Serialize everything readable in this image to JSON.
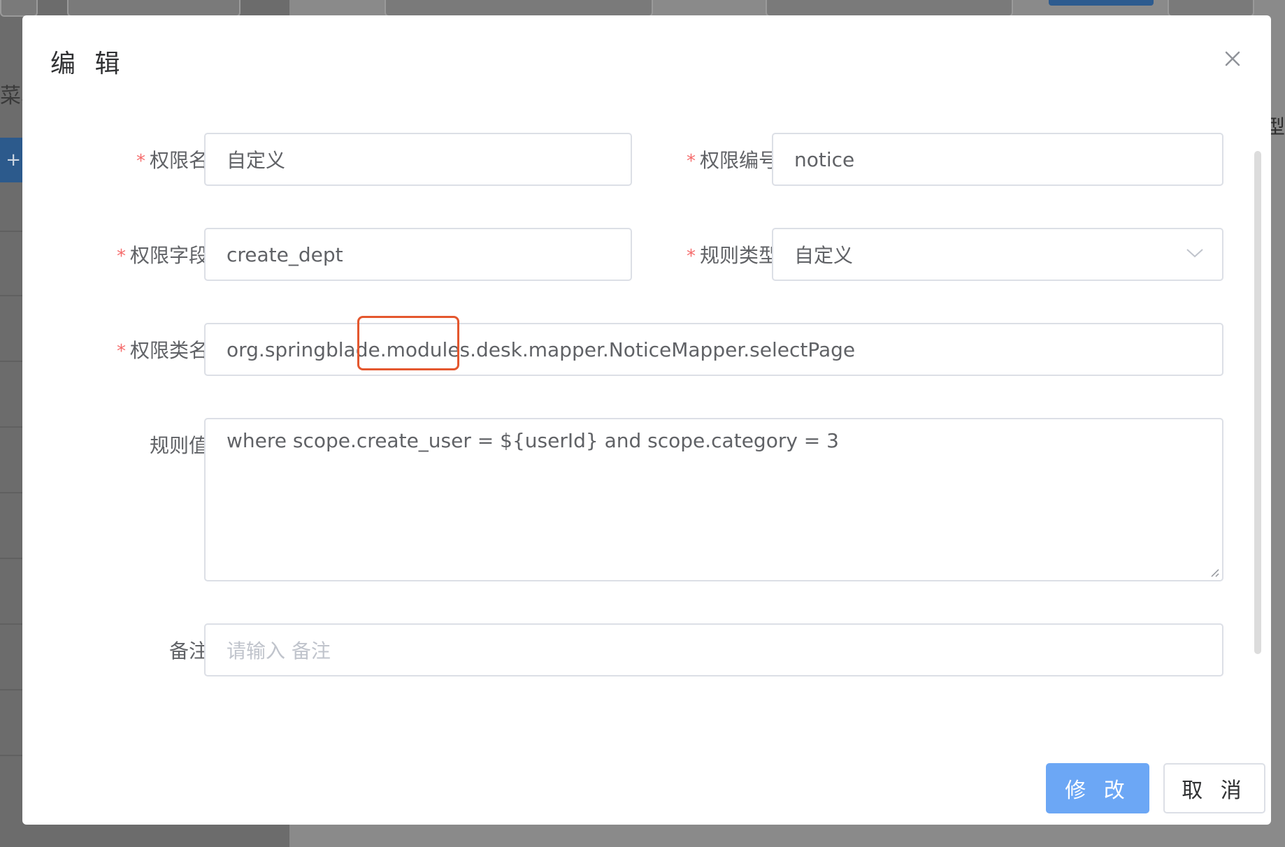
{
  "background": {
    "sidebar_fragment_text": "菜单",
    "right_fragment_text": "型"
  },
  "dialog": {
    "title": "编 辑",
    "close_icon": "close-icon",
    "required_mark": "*",
    "fields": {
      "permission_name": {
        "label": "权限名",
        "value": "自定义",
        "required": true
      },
      "permission_code": {
        "label": "权限编号",
        "value": "notice",
        "required": true
      },
      "permission_field": {
        "label": "权限字段",
        "value": "create_dept",
        "required": true
      },
      "rule_type": {
        "label": "规则类型",
        "value": "自定义",
        "required": true,
        "icon": "chevron-down-icon"
      },
      "permission_class": {
        "label": "权限类名",
        "value": "org.springblade.modules.desk.mapper.NoticeMapper.selectPage",
        "required": true
      },
      "rule_value": {
        "label": "规则值",
        "value": "where scope.create_user = ${userId} and scope.category = 3",
        "required": false
      },
      "remark": {
        "label": "备注",
        "value": "",
        "placeholder": "请输入 备注",
        "required": false
      }
    },
    "buttons": {
      "submit": "修 改",
      "cancel": "取 消"
    },
    "colors": {
      "primary": "#6ca7f5",
      "required": "#f56c6c",
      "highlight": "#e4572e"
    }
  }
}
